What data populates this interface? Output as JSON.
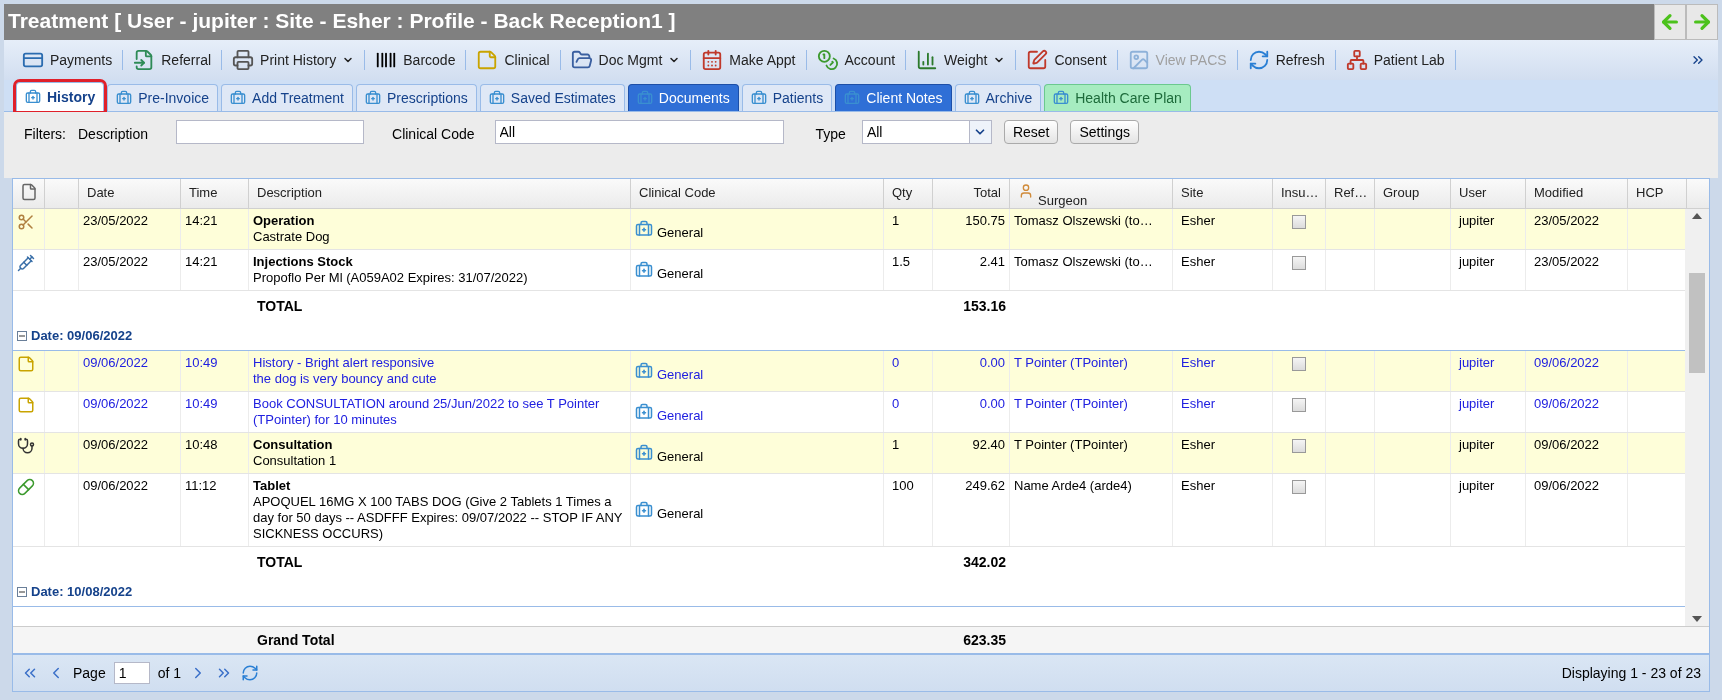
{
  "window": {
    "title": "Treatment [ User - jupiter : Site - Esher : Profile - Back Reception1 ]"
  },
  "toolbar": [
    {
      "label": "Payments",
      "dropdown": false,
      "disabled": false
    },
    {
      "label": "Referral",
      "dropdown": false,
      "disabled": false
    },
    {
      "label": "Print History",
      "dropdown": true,
      "disabled": false
    },
    {
      "label": "Barcode",
      "dropdown": false,
      "disabled": false
    },
    {
      "label": "Clinical",
      "dropdown": false,
      "disabled": false
    },
    {
      "label": "Doc Mgmt",
      "dropdown": true,
      "disabled": false
    },
    {
      "label": "Make Appt",
      "dropdown": false,
      "disabled": false
    },
    {
      "label": "Account",
      "dropdown": false,
      "disabled": false
    },
    {
      "label": "Weight",
      "dropdown": true,
      "disabled": false
    },
    {
      "label": "Consent",
      "dropdown": false,
      "disabled": false
    },
    {
      "label": "View PACS",
      "dropdown": false,
      "disabled": true
    },
    {
      "label": "Refresh",
      "dropdown": false,
      "disabled": false
    },
    {
      "label": "Patient Lab",
      "dropdown": false,
      "disabled": false
    }
  ],
  "tabs": [
    {
      "label": "History",
      "selected": true,
      "kind": "plain"
    },
    {
      "label": "Pre-Invoice",
      "selected": false,
      "kind": "plain"
    },
    {
      "label": "Add Treatment",
      "selected": false,
      "kind": "plain"
    },
    {
      "label": "Prescriptions",
      "selected": false,
      "kind": "plain"
    },
    {
      "label": "Saved Estimates",
      "selected": false,
      "kind": "plain"
    },
    {
      "label": "Documents",
      "selected": false,
      "kind": "blue"
    },
    {
      "label": "Patients",
      "selected": false,
      "kind": "plain"
    },
    {
      "label": "Client Notes",
      "selected": false,
      "kind": "blue"
    },
    {
      "label": "Archive",
      "selected": false,
      "kind": "plain"
    },
    {
      "label": "Health Care Plan",
      "selected": false,
      "kind": "green"
    }
  ],
  "filters": {
    "label": "Filters:",
    "description": {
      "label": "Description"
    },
    "clinical_code": {
      "label": "Clinical Code",
      "value": "All"
    },
    "type": {
      "label": "Type",
      "value": "All"
    },
    "buttons": [
      "Reset",
      "Settings"
    ]
  },
  "table": {
    "columns": [
      "Date",
      "Time",
      "Description",
      "Clinical Code",
      "Qty",
      "Total",
      "Surgeon",
      "Site",
      "Insu…",
      "Ref…",
      "Group",
      "User",
      "Modified",
      "HCP"
    ],
    "groups": [
      {
        "rows": [
          {
            "kind": "operation",
            "date": "23/05/2022",
            "time": "14:21",
            "title": "Operation",
            "description": [
              "Castrate Dog"
            ],
            "clinical_code": "General",
            "qty": "1",
            "total": "150.75",
            "surgeon": "Tomasz Olszewski (to…",
            "site": "Esher",
            "insured": false,
            "user": "jupiter",
            "modified": "23/05/2022"
          },
          {
            "kind": "injection",
            "date": "23/05/2022",
            "time": "14:21",
            "title": "Injections Stock",
            "description": [
              "Propoflo Per Ml (A059A02 Expires: 31/07/2022)"
            ],
            "clinical_code": "General",
            "qty": "1.5",
            "total": "2.41",
            "surgeon": "Tomasz Olszewski (to…",
            "site": "Esher",
            "insured": false,
            "user": "jupiter",
            "modified": "23/05/2022"
          }
        ],
        "total": {
          "label": "TOTAL",
          "value": "153.16"
        }
      },
      {
        "label": "Date: 09/06/2022",
        "rows": [
          {
            "kind": "note",
            "date": "09/06/2022",
            "time": "10:49",
            "description": [
              "History - Bright alert responsive",
              "the dog is very bouncy and cute"
            ],
            "clinical_code": "General",
            "qty": "0",
            "total": "0.00",
            "surgeon": "T Pointer (TPointer)",
            "site": "Esher",
            "insured": false,
            "user": "jupiter",
            "modified": "09/06/2022"
          },
          {
            "kind": "note",
            "date": "09/06/2022",
            "time": "10:49",
            "description": [
              "Book CONSULTATION around 25/Jun/2022 to see T Pointer (TPointer) for 10 minutes"
            ],
            "clinical_code": "General",
            "qty": "0",
            "total": "0.00",
            "surgeon": "T Pointer (TPointer)",
            "site": "Esher",
            "insured": false,
            "user": "jupiter",
            "modified": "09/06/2022"
          },
          {
            "kind": "consultation",
            "date": "09/06/2022",
            "time": "10:48",
            "title": "Consultation",
            "description": [
              "Consultation 1"
            ],
            "clinical_code": "General",
            "qty": "1",
            "total": "92.40",
            "surgeon": "T Pointer (TPointer)",
            "site": "Esher",
            "insured": false,
            "user": "jupiter",
            "modified": "09/06/2022"
          },
          {
            "kind": "tablet",
            "date": "09/06/2022",
            "time": "11:12",
            "title": "Tablet",
            "description": [
              "APOQUEL 16MG X 100 TABS DOG (Give 2 Tablets 1 Times a day for 50 days -- ASDFFF Expires: 09/07/2022 -- STOP IF ANY SICKNESS OCCURS)"
            ],
            "clinical_code": "General",
            "qty": "100",
            "total": "249.62",
            "surgeon": "Name Arde4 (arde4)",
            "site": "Esher",
            "insured": false,
            "user": "jupiter",
            "modified": "09/06/2022"
          }
        ],
        "total": {
          "label": "TOTAL",
          "value": "342.02"
        }
      },
      {
        "label": "Date: 10/08/2022"
      }
    ],
    "grand_total": {
      "label": "Grand Total",
      "value": "623.35"
    }
  },
  "pager": {
    "page_label": "Page",
    "page": "1",
    "of": "of 1",
    "status": "Displaying 1 - 23 of 23"
  }
}
